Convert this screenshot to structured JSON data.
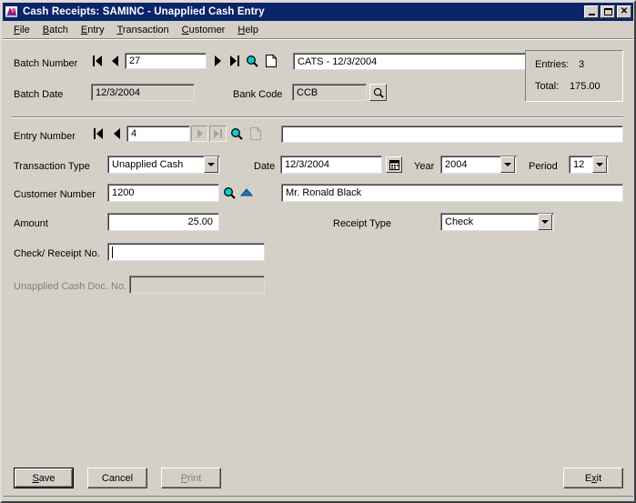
{
  "window": {
    "title": "Cash Receipts: SAMINC - Unapplied Cash Entry",
    "icon": "app-icon",
    "minimize_label": "_",
    "maximize_label": "",
    "close_label": "✕"
  },
  "menubar": {
    "items": [
      {
        "accel": "F",
        "rest": "ile",
        "name": "menu-file"
      },
      {
        "accel": "B",
        "rest": "atch",
        "name": "menu-batch"
      },
      {
        "accel": "E",
        "rest": "ntry",
        "name": "menu-entry"
      },
      {
        "accel": "T",
        "rest": "ransaction",
        "name": "menu-transaction"
      },
      {
        "accel": "C",
        "rest": "ustomer",
        "name": "menu-customer"
      },
      {
        "accel": "H",
        "rest": "elp",
        "name": "menu-help"
      }
    ]
  },
  "batch": {
    "number_label": "Batch Number",
    "number_value": "27",
    "description_value": "CATS - 12/3/2004",
    "date_label": "Batch Date",
    "date_value": "12/3/2004",
    "bank_code_label": "Bank Code",
    "bank_code_value": "CCB"
  },
  "summary": {
    "entries_label": "Entries:",
    "entries_value": "3",
    "total_label": "Total:",
    "total_value": "175.00"
  },
  "entry": {
    "number_label": "Entry Number",
    "number_value": "4",
    "description_value": "",
    "transaction_type_label": "Transaction Type",
    "transaction_type_value": "Unapplied Cash",
    "date_label": "Date",
    "date_value": "12/3/2004",
    "year_label": "Year",
    "year_value": "2004",
    "period_label": "Period",
    "period_value": "12",
    "customer_number_label": "Customer Number",
    "customer_number_value": "1200",
    "customer_name_value": "Mr. Ronald Black",
    "amount_label": "Amount",
    "amount_value": "25.00",
    "receipt_type_label": "Receipt Type",
    "receipt_type_value": "Check",
    "check_receipt_label": "Check/ Receipt No.",
    "check_receipt_value": "",
    "unapplied_doc_label": "Unapplied Cash Doc. No.",
    "unapplied_doc_value": ""
  },
  "buttons": {
    "save": {
      "accel": "S",
      "rest": "ave"
    },
    "cancel": {
      "accel": "",
      "rest": "Cancel"
    },
    "print": {
      "accel": "P",
      "rest": "rint"
    },
    "exit": {
      "pre": "E",
      "accel": "x",
      "rest": "it"
    }
  },
  "colors": {
    "titlebar": "#0a246a",
    "face": "#d4d0c8",
    "field": "#ffffff",
    "magnifier": "#00c8c8",
    "default_button_text": "#008000",
    "disabled_text": "#808080"
  }
}
